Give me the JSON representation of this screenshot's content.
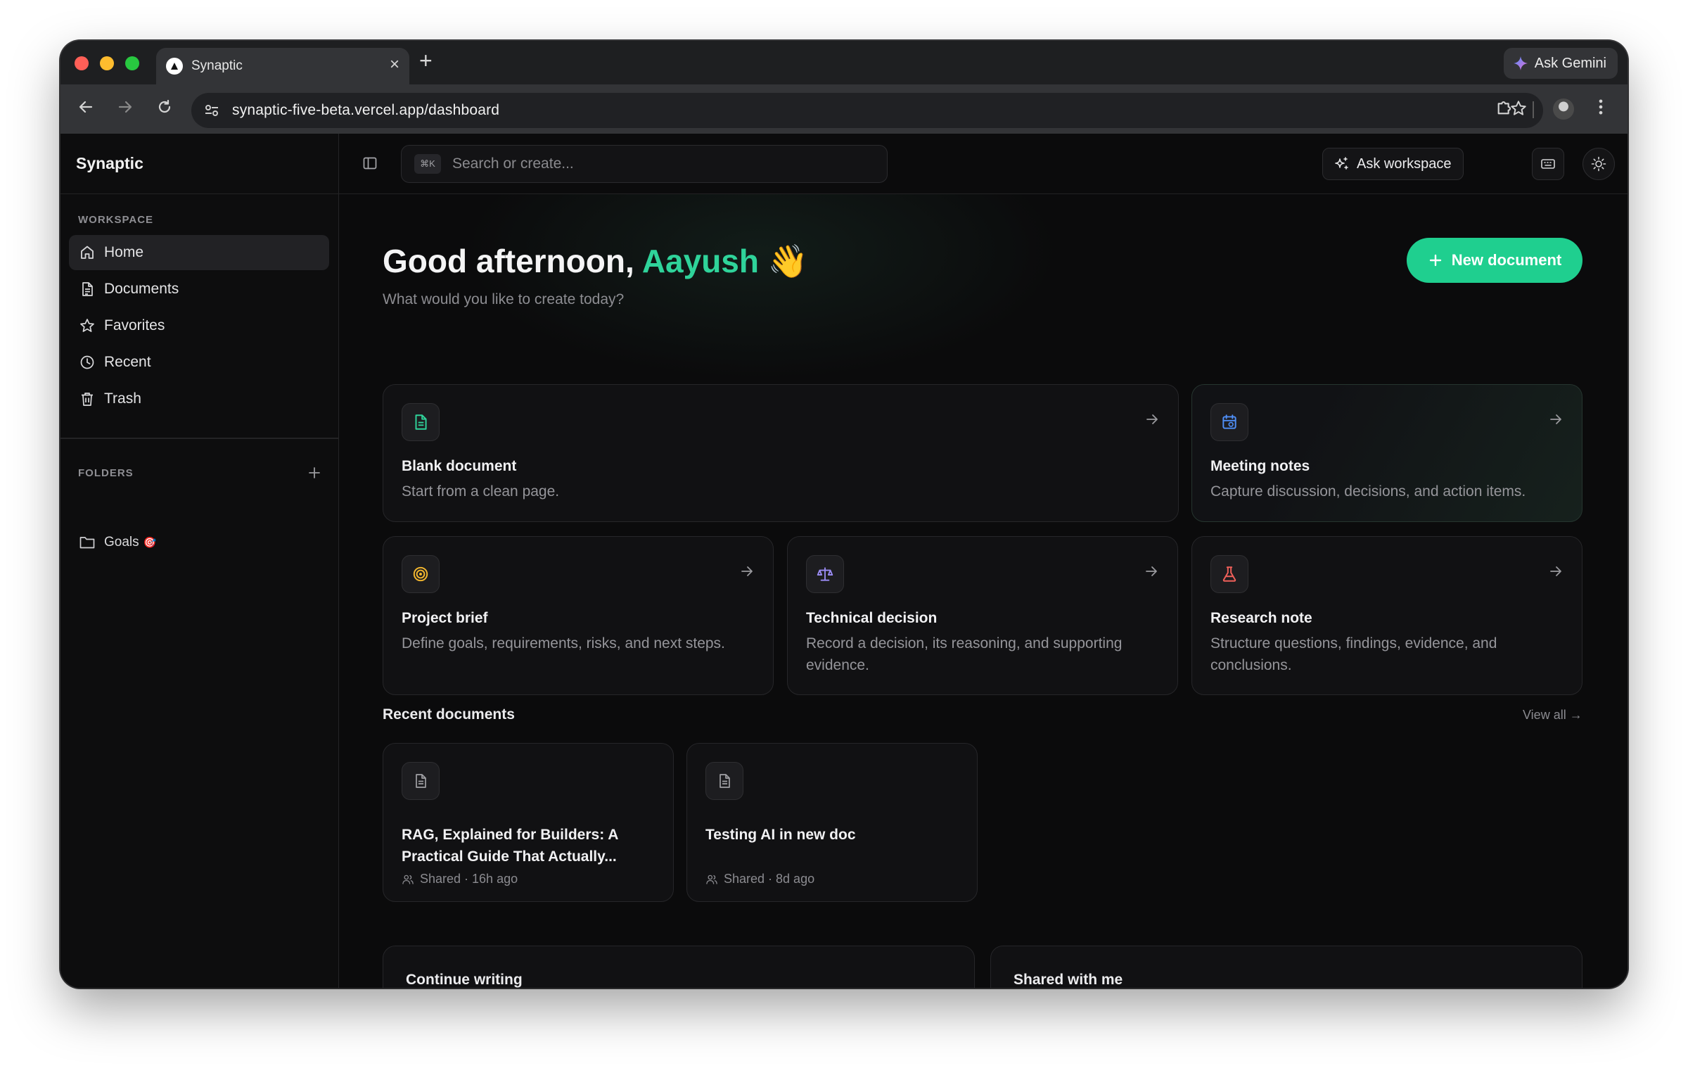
{
  "browser": {
    "tab_title": "Synaptic",
    "new_tab_symbol": "+",
    "close_symbol": "×",
    "ask_gemini": "Ask Gemini",
    "url": "synaptic-five-beta.vercel.app/dashboard"
  },
  "app": {
    "brand": "Synaptic",
    "sidebar": {
      "workspace_label": "WORKSPACE",
      "items": [
        {
          "label": "Home",
          "icon": "home-icon",
          "active": true
        },
        {
          "label": "Documents",
          "icon": "document-icon"
        },
        {
          "label": "Favorites",
          "icon": "star-icon"
        },
        {
          "label": "Recent",
          "icon": "clock-icon"
        },
        {
          "label": "Trash",
          "icon": "trash-icon"
        }
      ],
      "folders_label": "FOLDERS",
      "folders": [
        {
          "label": "Goals",
          "emoji": "🎯"
        }
      ]
    },
    "topbar": {
      "search_kbd": "⌘K",
      "search_placeholder": "Search or create...",
      "ask_workspace": "Ask workspace"
    },
    "greeting": {
      "prefix": "Good afternoon, ",
      "name": "Aayush",
      "emoji": "👋",
      "subtitle": "What would you like to create today?"
    },
    "new_document": "New document",
    "templates": [
      {
        "title": "Blank document",
        "desc": "Start from a clean page.",
        "icon": "document-icon",
        "color": "#2fd39a"
      },
      {
        "title": "Meeting notes",
        "desc": "Capture discussion, decisions, and action items.",
        "icon": "calendar-icon",
        "color": "#4f8ff7"
      },
      {
        "title": "Project brief",
        "desc": "Define goals, requirements, risks, and next steps.",
        "icon": "target-icon",
        "color": "#f5b82e"
      },
      {
        "title": "Technical decision",
        "desc": "Record a decision, its reasoning, and supporting evidence.",
        "icon": "scale-icon",
        "color": "#9b8cf5"
      },
      {
        "title": "Research note",
        "desc": "Structure questions, findings, evidence, and conclusions.",
        "icon": "flask-icon",
        "color": "#f0605a"
      }
    ],
    "recent": {
      "title": "Recent documents",
      "view_all": "View all →",
      "docs": [
        {
          "title": "RAG, Explained for Builders: A Practical Guide That Actually...",
          "meta": "Shared · 16h ago"
        },
        {
          "title": "Testing AI in new doc",
          "meta": "Shared · 8d ago"
        }
      ]
    },
    "bottom": {
      "continue": "Continue writing",
      "shared": "Shared with me"
    }
  },
  "colors": {
    "accent": "#1fcf8f",
    "name": "#2fd39a"
  }
}
